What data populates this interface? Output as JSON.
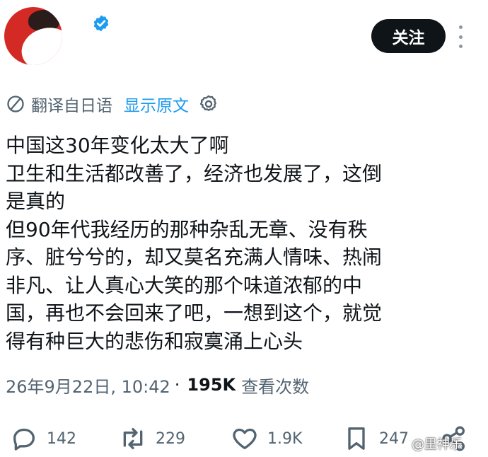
{
  "header": {
    "follow_label": "关注",
    "verified_icon": "verified-badge-icon",
    "more_icon": "more-vertical-icon"
  },
  "translation": {
    "label": "翻译自日语",
    "show_original": "显示原文",
    "icon": "translate-icon",
    "settings_icon": "gear-icon"
  },
  "tweet": {
    "lines": [
      "中国这30年变化太大了啊",
      "卫生和生活都改善了，经济也发展了，这倒",
      "是真的",
      "但90年代我经历的那种杂乱无章、没有秩",
      "序、脏兮兮的，却又莫名充满人情味、热闹",
      "非凡、让人真心大笑的那个味道浓郁的中",
      "国，再也不会回来了吧，一想到这个，就觉",
      "得有种巨大的悲伤和寂寞涌上心头"
    ]
  },
  "meta": {
    "timestamp": "26年9月22日, 10:42",
    "separator": "·",
    "views_count": "195K",
    "views_label": "查看次数"
  },
  "actions": {
    "reply_count": "142",
    "retweet_count": "229",
    "like_count": "1.9K",
    "bookmark_count": "247"
  },
  "watermark": "@里神乐",
  "colors": {
    "accent": "#1d9bf0",
    "text": "#0f1419",
    "muted": "#536471",
    "avatar_bg": "#d42a25"
  }
}
